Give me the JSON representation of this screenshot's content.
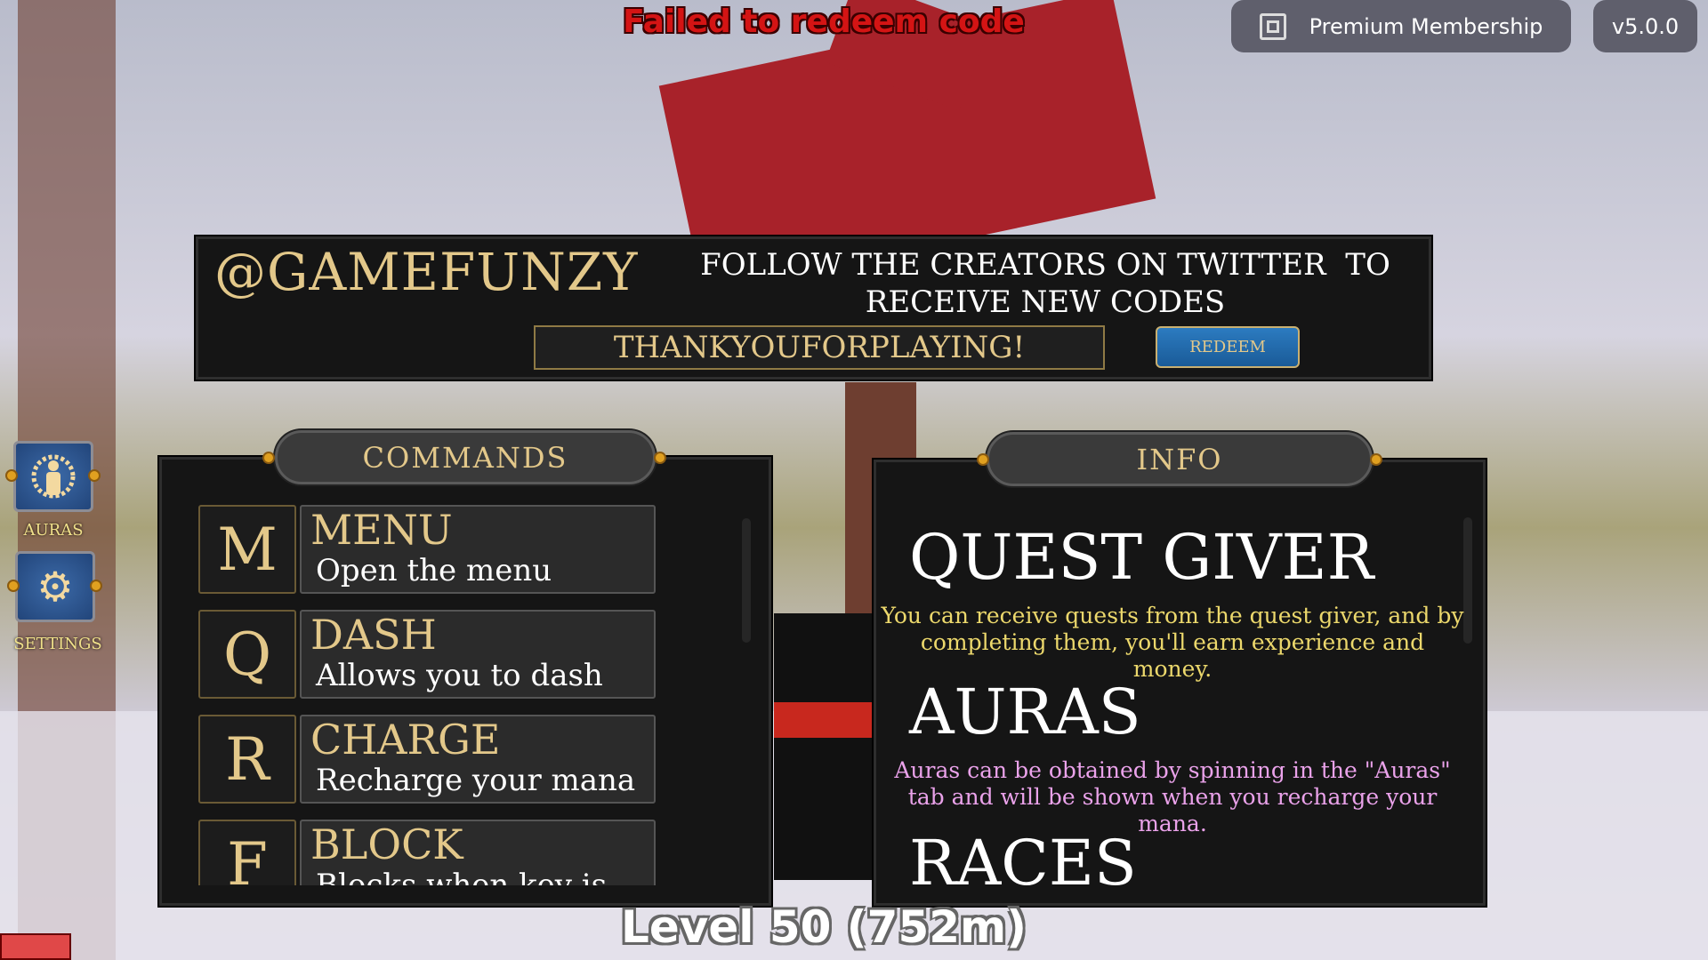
{
  "notification": "Failed to redeem code",
  "top_bar": {
    "premium_label": "Premium Membership",
    "premium_icon": "premium-logo-icon",
    "version": "v5.0.0"
  },
  "codes_panel": {
    "handle": "@GAMEFUNZY",
    "message_line1": "FOLLOW THE CREATORS ON TWITTER  TO",
    "message_line2": "RECEIVE NEW CODES",
    "code_value": "THANKYOUFORPLAYING!",
    "redeem_label": "REDEEM"
  },
  "commands": {
    "title": "COMMANDS",
    "items": [
      {
        "key": "M",
        "name": "MENU",
        "desc": "Open the menu"
      },
      {
        "key": "Q",
        "name": "DASH",
        "desc": "Allows you to dash"
      },
      {
        "key": "R",
        "name": "CHARGE",
        "desc": "Recharge your mana"
      },
      {
        "key": "F",
        "name": "BLOCK",
        "desc": "Blocks when key is held"
      }
    ]
  },
  "info": {
    "title": "INFO",
    "sections": [
      {
        "heading": "QUEST GIVER",
        "text": "You can receive quests from the quest giver, and by completing them, you'll earn experience and money.",
        "color": "#ecd86c"
      },
      {
        "heading": "AURAS",
        "text": "Auras can be obtained by spinning in the \"Auras\" tab and will be shown when you recharge your mana.",
        "color": "#eaa2ea"
      },
      {
        "heading": "RACES",
        "text": ""
      }
    ]
  },
  "sidebar": {
    "items": [
      {
        "label": "AURAS",
        "icon": "aura-figure-icon"
      },
      {
        "label": "SETTINGS",
        "icon": "gear-icon"
      }
    ]
  },
  "level_text": "Level 50 (752m)"
}
